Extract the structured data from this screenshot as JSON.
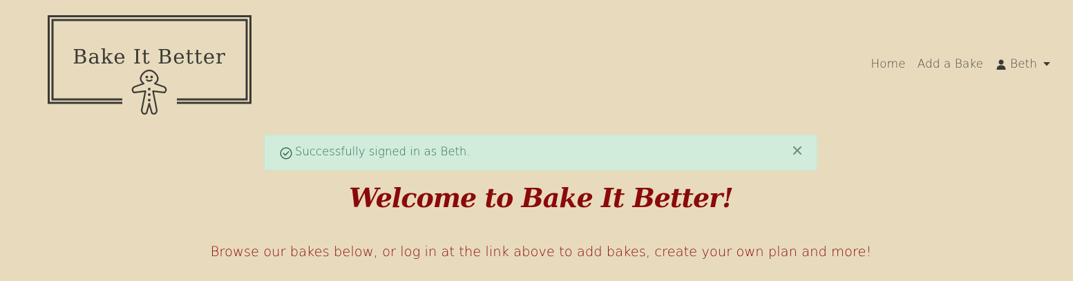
{
  "brand": {
    "logo_text": "Bake It Better"
  },
  "nav": {
    "home_label": "Home",
    "add_label": "Add a Bake",
    "user_label": "Beth"
  },
  "alert": {
    "message": "Successfully signed in as Beth.",
    "close_glyph": "✕"
  },
  "main": {
    "title": "Welcome to Bake It Better!",
    "subtitle": "Browse our bakes below, or log in at the link above to add bakes, create your own plan and more!"
  },
  "icons": {
    "logo": "gingerbread-man-icon",
    "user": "user-icon",
    "caret": "caret-down-icon",
    "success": "check-circle-icon",
    "close": "close-icon"
  },
  "colors": {
    "background": "#e8dbbd",
    "heading": "#8a0a0a",
    "alert_bg": "#d2ecdc",
    "alert_text": "#2e6a4b",
    "logo_ink": "#3b3a36"
  }
}
